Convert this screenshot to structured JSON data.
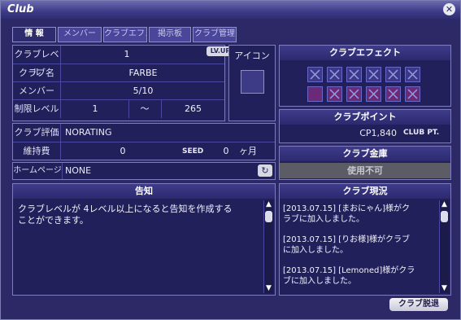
{
  "window": {
    "title": "Club"
  },
  "tabs": [
    {
      "label": "情 報"
    },
    {
      "label": "メンバー"
    },
    {
      "label": "クラブエフェクト"
    },
    {
      "label": "掲示板"
    },
    {
      "label": "クラブ管理"
    }
  ],
  "info": {
    "club_level_label": "クラブレベル",
    "club_level_value": "1",
    "lvup_label": "LV.UP",
    "club_name_label": "クラブ名",
    "club_name_value": "FARBE",
    "member_label": "メンバー",
    "member_value": "5/10",
    "limit_level_label": "制限レベル",
    "limit_level_min": "1",
    "limit_level_sep": "～",
    "limit_level_max": "265",
    "rating_label": "クラブ評価",
    "rating_value": "NORATING",
    "upkeep_label": "維持費",
    "upkeep_value": "0",
    "seed_label": "SEED",
    "months_value": "0",
    "months_unit": "ヶ月",
    "homepage_label": "ホームページ",
    "homepage_value": "NONE"
  },
  "icon_section": {
    "label": "アイコン"
  },
  "effects": {
    "title": "クラブエフェクト",
    "row1": [
      "locked",
      "locked",
      "locked",
      "locked",
      "locked",
      "locked"
    ],
    "row2": [
      "empty",
      "locked",
      "locked",
      "locked",
      "locked",
      "locked"
    ]
  },
  "points": {
    "title": "クラブポイント",
    "value": "CP1,840",
    "unit": "CLUB PT."
  },
  "vault": {
    "title": "クラブ金庫",
    "status": "使用不可"
  },
  "notice": {
    "title": "告知",
    "text_line1": "クラブレベルが 4レベル以上になると告知を作成する",
    "text_line2": "ことができます。"
  },
  "status": {
    "title": "クラブ現況",
    "entries": [
      {
        "line1": "[2013.07.15] [まおにゃん]様がク",
        "line2": "ラブに加入しました。"
      },
      {
        "line1": "[2013.07.15] [りお様]様がクラブ",
        "line2": "に加入しました。"
      },
      {
        "line1": "[2013.07.15] [Lemoned]様がクラ",
        "line2": "ブに加入しました。"
      }
    ]
  },
  "footer": {
    "disband_label": "クラブ脱退"
  },
  "colors": {
    "accent": "#2c2966",
    "header": "#3f3c8a",
    "locked_box": "#6a2a78"
  }
}
